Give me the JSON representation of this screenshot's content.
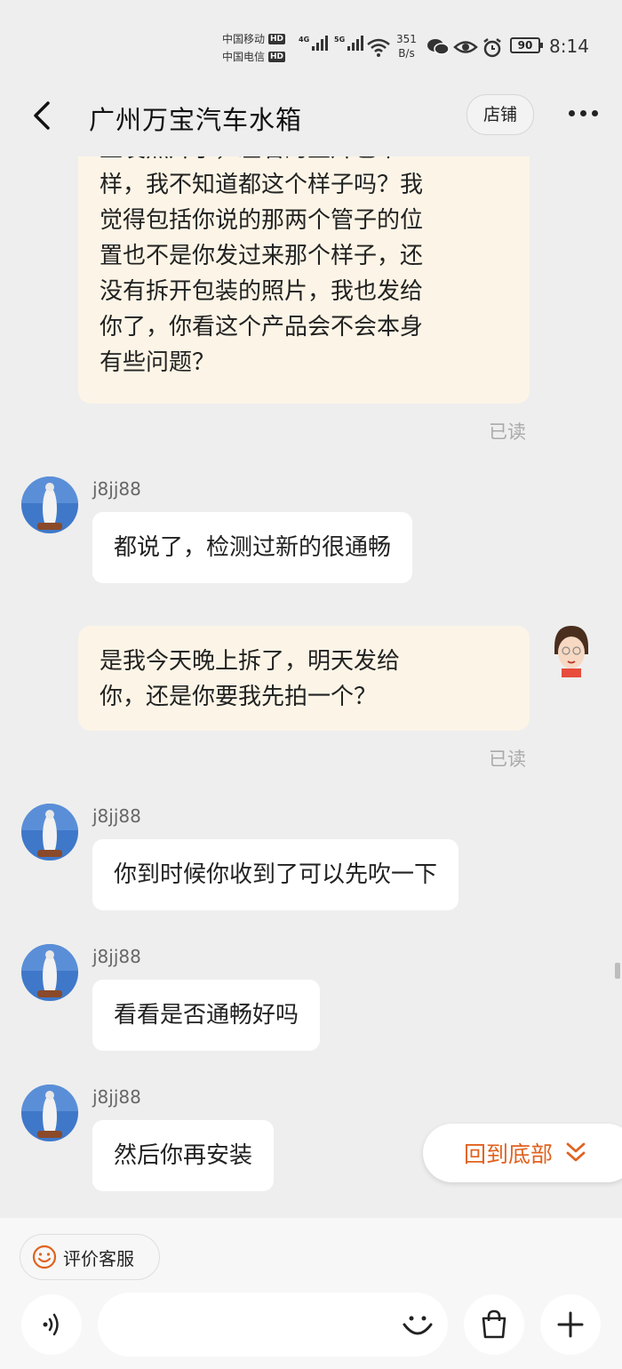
{
  "status_bar": {
    "carrier1": "中国移动",
    "carrier2": "中国电信",
    "hd_badge": "HD",
    "net1": "4G",
    "net2": "5G",
    "speed_value": "351",
    "speed_unit": "B/s",
    "battery": "90",
    "time": "8:14",
    "icons": [
      "wechat-icon",
      "eye-icon",
      "alarm-icon"
    ]
  },
  "header": {
    "title": "广州万宝汽车水箱",
    "shop_label": "店铺",
    "back_icon": "chevron-left-icon",
    "more_icon": "more-dots-icon"
  },
  "messages": {
    "m1": {
      "lines": [
        "上发照片了，左右的垫片也不",
        "样，我不知道都这个样子吗？我",
        "觉得包括你说的那两个管子的位",
        "置也不是你发过来那个样子，还",
        "没有拆开包装的照片，我也发给",
        "你了，你看这个产品会不会本身",
        "有些问题？"
      ],
      "status": "已读"
    },
    "m2": {
      "user": "j8jj88",
      "text": "都说了，检测过新的很通畅"
    },
    "m3": {
      "lines": [
        "是我今天晚上拆了，明天发给",
        "你，还是你要我先拍一个？"
      ],
      "status": "已读"
    },
    "m4": {
      "user": "j8jj88",
      "text": "你到时候你收到了可以先吹一下"
    },
    "m5": {
      "user": "j8jj88",
      "text": "看看是否通畅好吗"
    },
    "m6": {
      "user": "j8jj88",
      "text": "然后你再安装"
    }
  },
  "back_to_bottom": {
    "label": "回到底部",
    "icon": "double-chevron-down-icon"
  },
  "bottom_bar": {
    "rate_label": "评价客服",
    "rate_icon": "smile-icon",
    "voice_icon": "voice-icon",
    "emoji_icon": "emoji-icon",
    "bag_icon": "shopping-bag-icon",
    "plus_icon": "plus-icon",
    "input_placeholder": ""
  },
  "colors": {
    "accent": "#e0621f",
    "outgoing_bubble": "#fcf5e7",
    "incoming_bubble": "#ffffff",
    "background": "#eeeeee"
  }
}
